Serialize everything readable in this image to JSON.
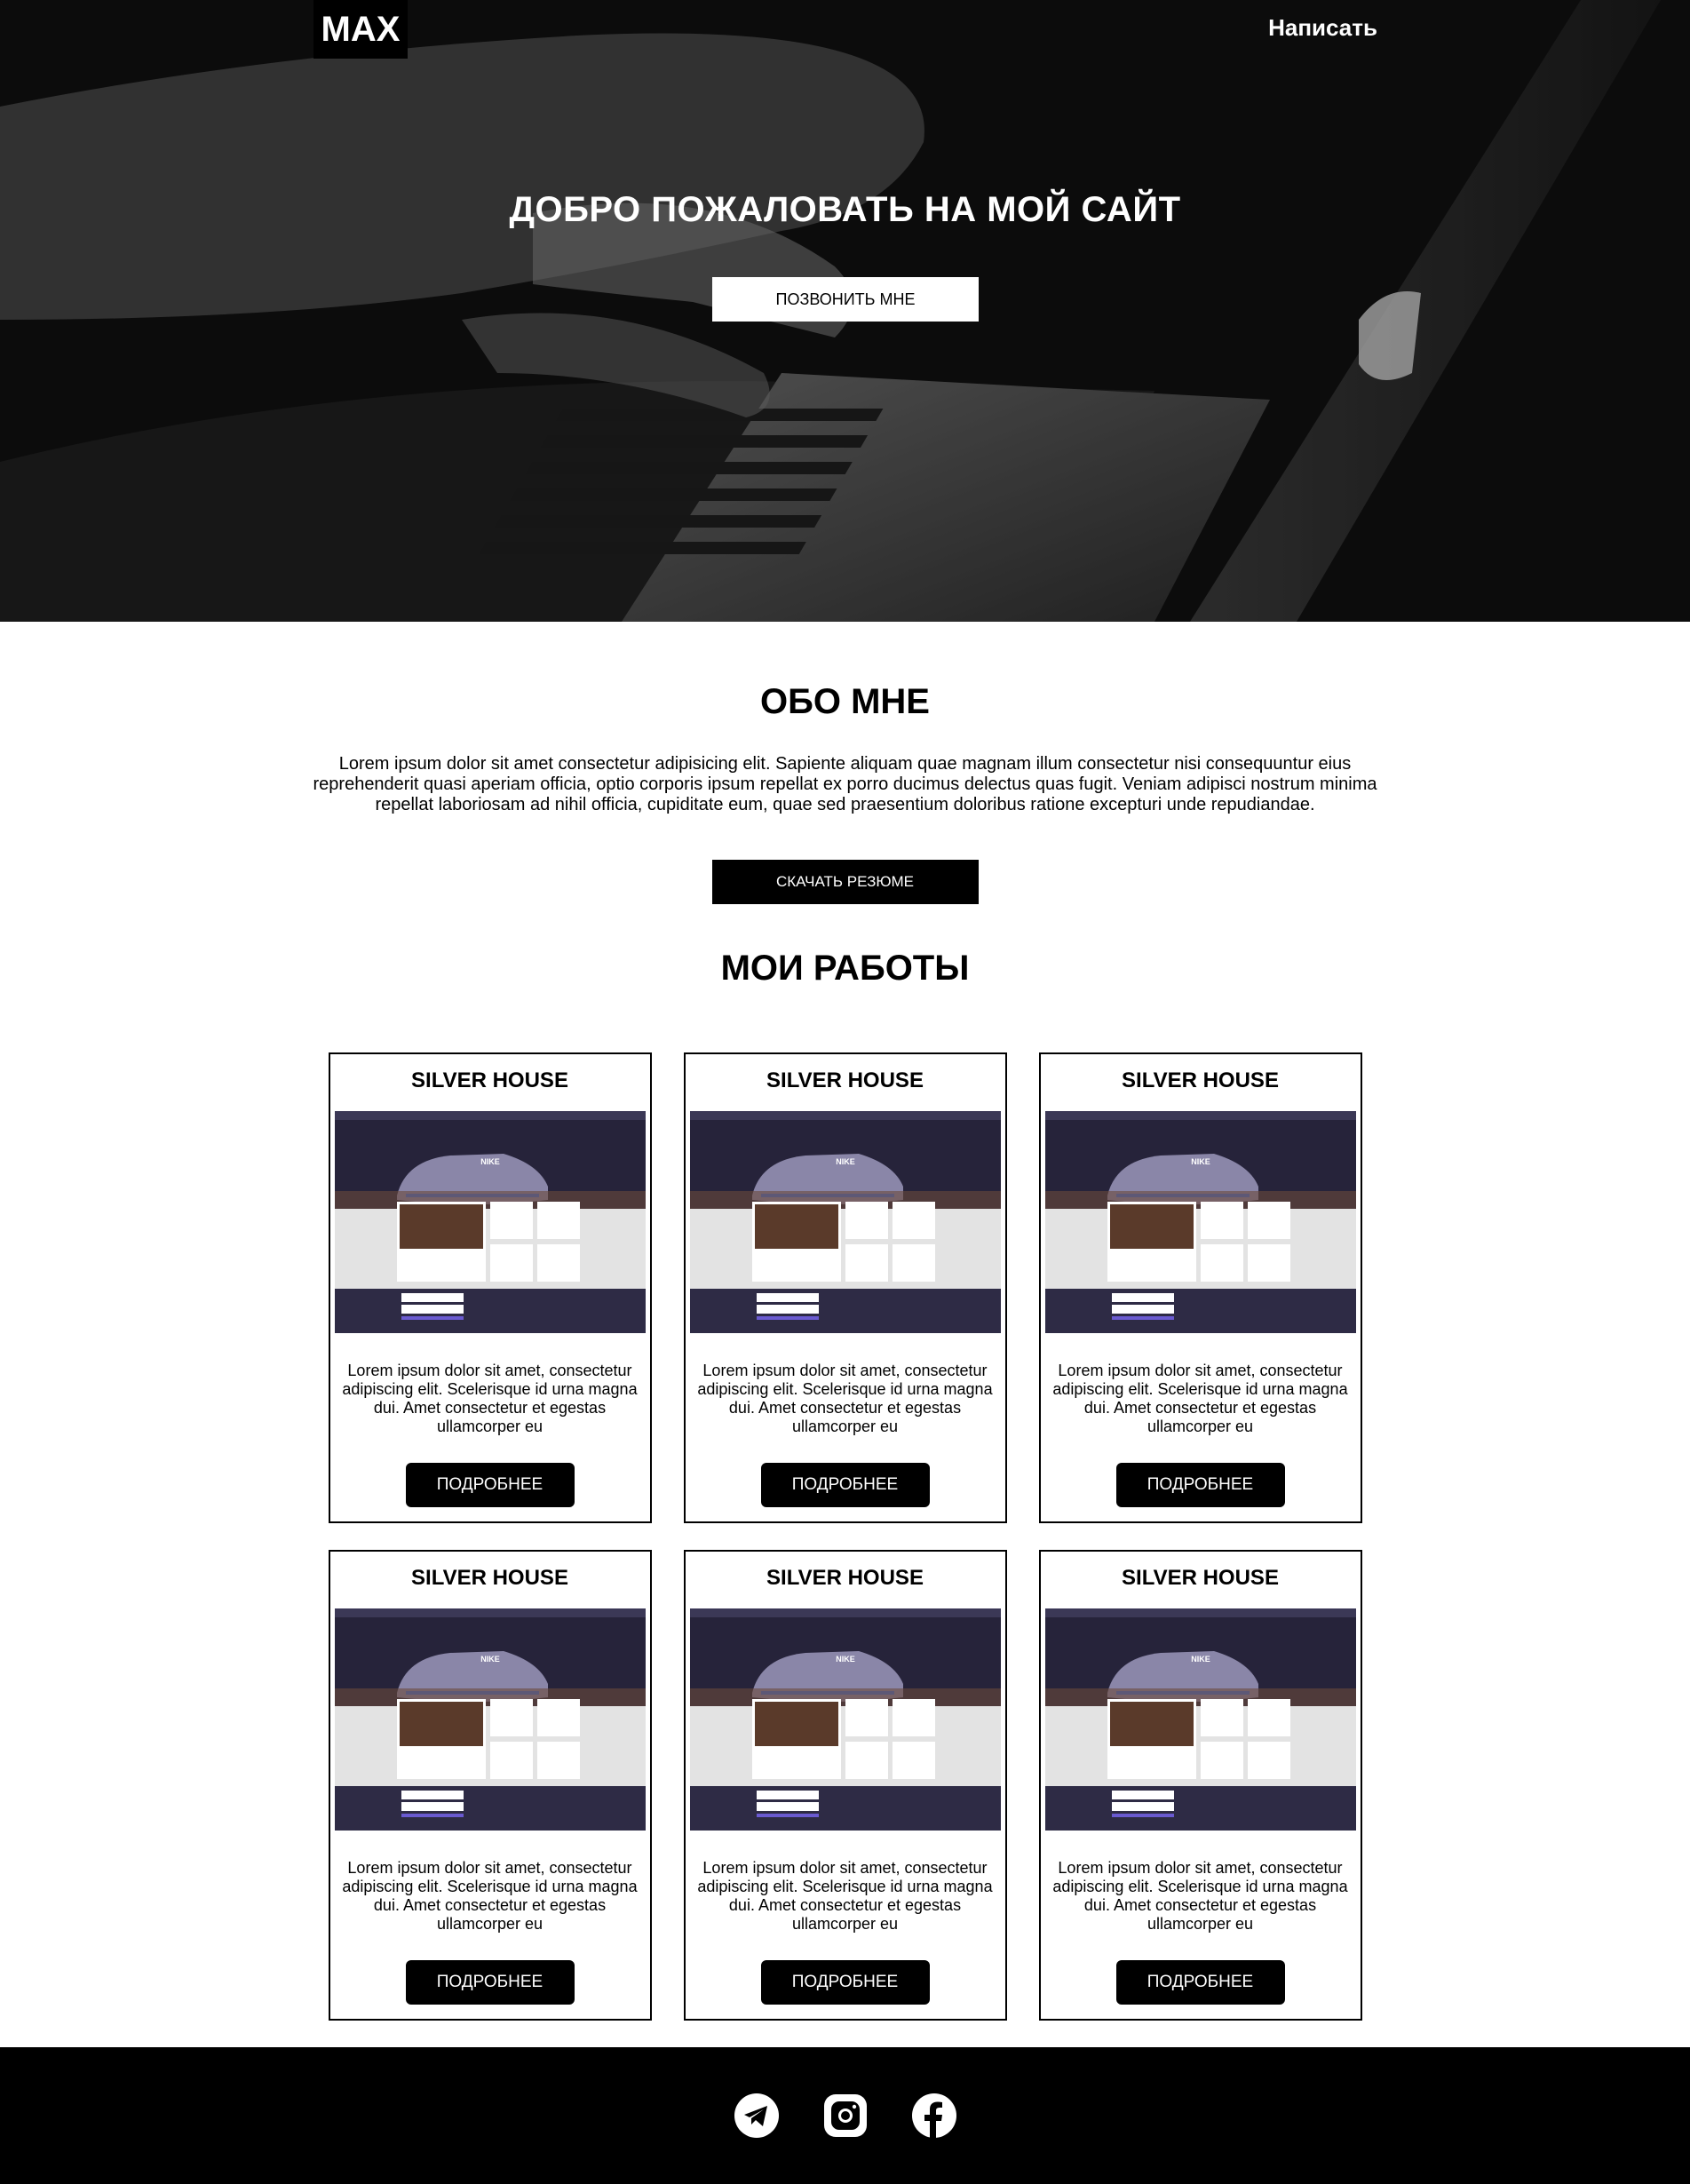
{
  "header": {
    "logo": "MAX",
    "nav_link": "Написать"
  },
  "hero": {
    "title": "ДОБРО ПОЖАЛОВАТЬ НА МОЙ САЙТ",
    "button": "ПОЗВОНИТЬ МНЕ"
  },
  "about": {
    "title": "ОБО МНЕ",
    "text": "Lorem ipsum dolor sit amet consectetur adipisicing elit. Sapiente aliquam quae magnam illum consectetur nisi consequuntur eius reprehenderit quasi aperiam officia, optio corporis ipsum repellat ex porro ducimus delectus quas fugit. Veniam adipisci nostrum minima repellat laboriosam ad nihil officia, cupiditate eum, quae sed praesentium doloribus ratione excepturi unde repudiandae.",
    "button": "СКАЧАТЬ РЕЗЮМЕ"
  },
  "works": {
    "title": "МОИ РАБОТЫ",
    "cards": [
      {
        "title": "SILVER HOUSE",
        "text": "Lorem ipsum dolor sit amet, consectetur adipiscing elit. Scelerisque id urna magna dui. Amet consectetur et egestas ullamcorper eu",
        "button": "ПОДРОБНЕЕ"
      },
      {
        "title": "SILVER HOUSE",
        "text": "Lorem ipsum dolor sit amet, consectetur adipiscing elit. Scelerisque id urna magna dui. Amet consectetur et egestas ullamcorper eu",
        "button": "ПОДРОБНЕЕ"
      },
      {
        "title": "SILVER HOUSE",
        "text": "Lorem ipsum dolor sit amet, consectetur adipiscing elit. Scelerisque id urna magna dui. Amet consectetur et egestas ullamcorper eu",
        "button": "ПОДРОБНЕЕ"
      },
      {
        "title": "SILVER HOUSE",
        "text": "Lorem ipsum dolor sit amet, consectetur adipiscing elit. Scelerisque id urna magna dui. Amet consectetur et egestas ullamcorper eu",
        "button": "ПОДРОБНЕЕ"
      },
      {
        "title": "SILVER HOUSE",
        "text": "Lorem ipsum dolor sit amet, consectetur adipiscing elit. Scelerisque id urna magna dui. Amet consectetur et egestas ullamcorper eu",
        "button": "ПОДРОБНЕЕ"
      },
      {
        "title": "SILVER HOUSE",
        "text": "Lorem ipsum dolor sit amet, consectetur adipiscing elit. Scelerisque id urna magna dui. Amet consectetur et egestas ullamcorper eu",
        "button": "ПОДРОБНЕЕ"
      }
    ],
    "thumbnail_label": "NIKE"
  },
  "footer": {
    "icons": [
      "telegram-icon",
      "instagram-icon",
      "facebook-icon"
    ]
  },
  "colors": {
    "hero_overlay": "#1a1a1a",
    "button_dark": "#000000",
    "thumb_dark": "#2e2b45"
  }
}
